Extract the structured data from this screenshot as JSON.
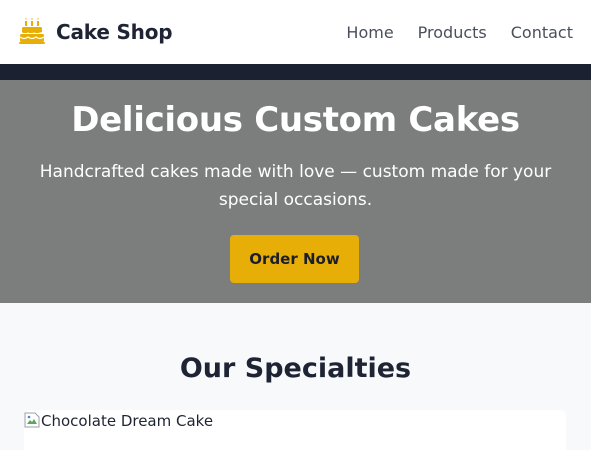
{
  "navbar": {
    "brand": "Cake Shop",
    "brand_icon": "birthday-cake-icon",
    "links": [
      {
        "label": "Home"
      },
      {
        "label": "Products"
      },
      {
        "label": "Contact"
      }
    ]
  },
  "hero": {
    "title": "Delicious Custom Cakes",
    "subtitle": "Handcrafted cakes made with love — custom made for your special occasions.",
    "cta_label": "Order Now"
  },
  "specialties": {
    "title": "Our Specialties",
    "items": [
      {
        "image_alt": "Chocolate Dream Cake"
      }
    ]
  },
  "colors": {
    "accent": "#e8ae08",
    "hero_bg": "#7c7e7d",
    "dark_band": "#1b2131",
    "text_dark": "#1e2433"
  }
}
